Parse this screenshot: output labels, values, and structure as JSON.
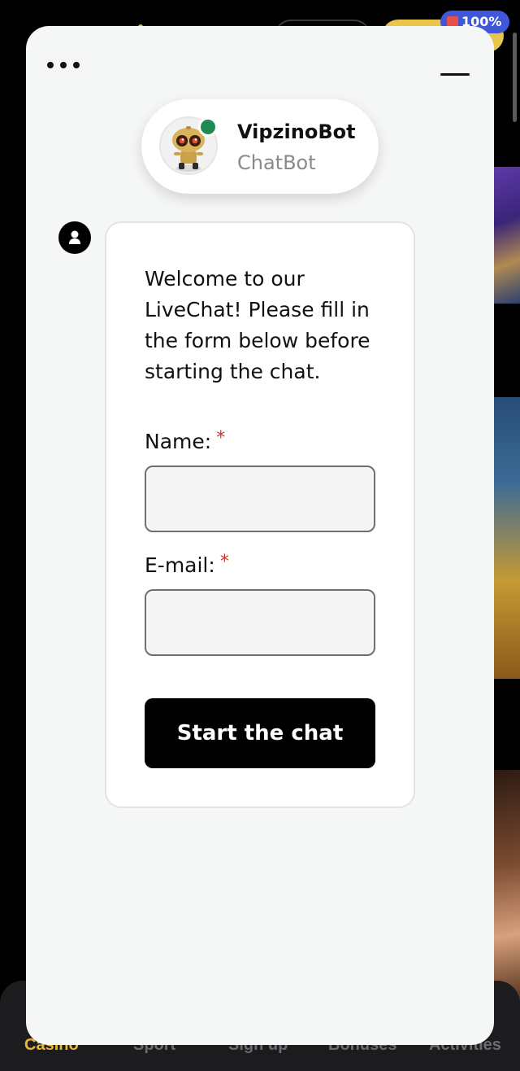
{
  "background": {
    "badge_text": "100%",
    "nav_items": [
      "Casino",
      "Sport",
      "Sign up",
      "Bonuses",
      "Activities"
    ],
    "active_nav": "Casino"
  },
  "chat": {
    "menu_icon": "more-dots-icon",
    "minimize_icon": "minimize-icon",
    "agent": {
      "name": "VipzinoBot",
      "role": "ChatBot",
      "status": "online",
      "status_color": "#1f8a54"
    },
    "welcome_message": "Welcome to our LiveChat! Please fill in the form below before starting the chat.",
    "form": {
      "name_label": "Name:",
      "name_value": "",
      "email_label": "E-mail:",
      "email_value": "",
      "required_marker": "*",
      "submit_label": "Start the chat"
    }
  },
  "colors": {
    "accent": "#e7b93a",
    "required": "#d0322a",
    "button": "#000000"
  }
}
